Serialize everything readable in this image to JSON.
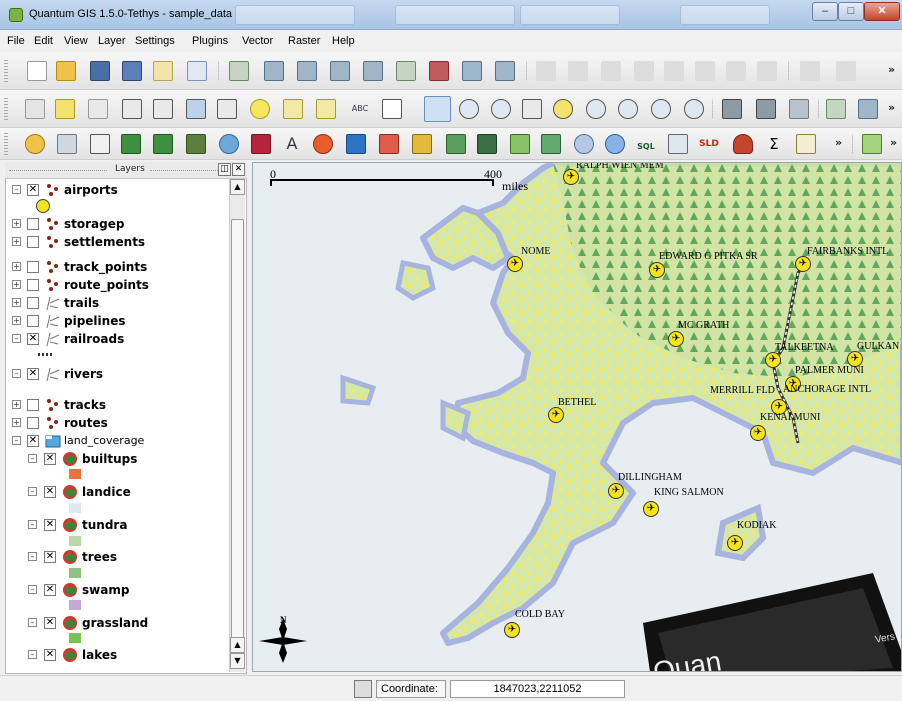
{
  "window": {
    "title": "Quantum GIS 1.5.0-Tethys - sample_data"
  },
  "menu": [
    "File",
    "Edit",
    "View",
    "Layer",
    "Settings",
    "Plugins",
    "Vector",
    "Raster",
    "Help"
  ],
  "toolbar_text": {
    "label_tool": "ABC",
    "sql": "SQL",
    "sld": "SLD",
    "sigma": "Σ",
    "more": "»"
  },
  "panel": {
    "title": "Layers"
  },
  "layers": [
    {
      "name": "airports",
      "checked": true,
      "expanded": true
    },
    {
      "name": "storagep",
      "checked": false,
      "expanded": false
    },
    {
      "name": "settlements",
      "checked": false,
      "expanded": false
    },
    {
      "name": "track_points",
      "checked": false,
      "expanded": false
    },
    {
      "name": "route_points",
      "checked": false,
      "expanded": false
    },
    {
      "name": "trails",
      "checked": false,
      "expanded": false
    },
    {
      "name": "pipelines",
      "checked": false,
      "expanded": false
    },
    {
      "name": "railroads",
      "checked": true,
      "expanded": true
    },
    {
      "name": "rivers",
      "checked": true,
      "expanded": true
    },
    {
      "name": "tracks",
      "checked": false,
      "expanded": false
    },
    {
      "name": "routes",
      "checked": false,
      "expanded": false
    },
    {
      "name": "land_coverage",
      "checked": true,
      "expanded": true
    }
  ],
  "land_coverage_sublayers": [
    {
      "name": "builtups",
      "color": "#e8743b"
    },
    {
      "name": "landice",
      "color": "#dde9ee"
    },
    {
      "name": "tundra",
      "color": "#b9d8a4"
    },
    {
      "name": "trees",
      "color": "#8fc480"
    },
    {
      "name": "swamp",
      "color": "#c4a8d8"
    },
    {
      "name": "grassland",
      "color": "#78c257"
    },
    {
      "name": "lakes",
      "color": "#8fb4e3"
    }
  ],
  "map": {
    "scale_start": "0",
    "scale_end": "400",
    "scale_unit": "miles",
    "north_label": "N",
    "airports": [
      "RALPH WIEN MEM",
      "NOME",
      "EDWARD G PITKA SR",
      "FAIRBANKS INTL",
      "MC GRATH",
      "TALKEETNA",
      "GULKAN",
      "PALMER MUNI",
      "MERRILL FLD",
      "ANCHORAGE INTL",
      "KENAI MUNI",
      "BETHEL",
      "DILLINGHAM",
      "KING SALMON",
      "KODIAK",
      "COLD BAY"
    ],
    "splash_text": {
      "version": "Vers",
      "logo": "Quan"
    }
  },
  "status": {
    "coordinate_label": "Coordinate:",
    "coordinate_value": "1847023,2211052"
  },
  "colors": {
    "water": "#e8edf1",
    "land": "#cfe3a5",
    "forest": "#5ea95a",
    "coast": "#a8b4e0",
    "airport": "#f5e31b"
  }
}
